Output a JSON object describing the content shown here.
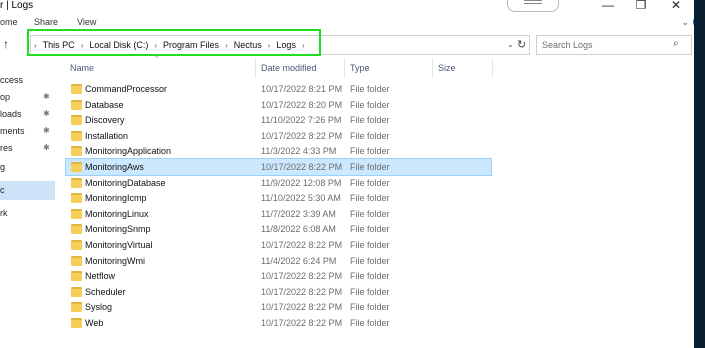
{
  "window": {
    "title": "r | Logs",
    "minimize": "—",
    "maximize": "❐",
    "close": "✕"
  },
  "ribbon": {
    "tabs": [
      "ome",
      "Share",
      "View"
    ]
  },
  "address": {
    "crumbs": [
      "This PC",
      "Local Disk (C:)",
      "Program Files",
      "Nectus",
      "Logs"
    ],
    "highlight_color": "#22dd22"
  },
  "search": {
    "placeholder": "Search Logs"
  },
  "sidebar": {
    "items": [
      {
        "label": "ccess",
        "pinned": false
      },
      {
        "label": "op",
        "pinned": true
      },
      {
        "label": "loads",
        "pinned": true
      },
      {
        "label": "ments",
        "pinned": true
      },
      {
        "label": "res",
        "pinned": true
      },
      {
        "label": "g",
        "pinned": false
      },
      {
        "label": "c",
        "pinned": false,
        "selected": true
      },
      {
        "label": "rk",
        "pinned": false
      }
    ]
  },
  "columns": {
    "name": "Name",
    "date": "Date modified",
    "type": "Type",
    "size": "Size"
  },
  "files": [
    {
      "name": "CommandProcessor",
      "date": "10/17/2022 8:21 PM",
      "type": "File folder"
    },
    {
      "name": "Database",
      "date": "10/17/2022 8:20 PM",
      "type": "File folder"
    },
    {
      "name": "Discovery",
      "date": "11/10/2022 7:26 PM",
      "type": "File folder"
    },
    {
      "name": "Installation",
      "date": "10/17/2022 8:22 PM",
      "type": "File folder"
    },
    {
      "name": "MonitoringApplication",
      "date": "11/3/2022 4:33 PM",
      "type": "File folder"
    },
    {
      "name": "MonitoringAws",
      "date": "10/17/2022 8:22 PM",
      "type": "File folder",
      "selected": true
    },
    {
      "name": "MonitoringDatabase",
      "date": "11/9/2022 12:08 PM",
      "type": "File folder"
    },
    {
      "name": "MonitoringIcmp",
      "date": "11/10/2022 5:30 AM",
      "type": "File folder"
    },
    {
      "name": "MonitoringLinux",
      "date": "11/7/2022 3:39 AM",
      "type": "File folder"
    },
    {
      "name": "MonitoringSnmp",
      "date": "11/8/2022 6:08 AM",
      "type": "File folder"
    },
    {
      "name": "MonitoringVirtual",
      "date": "10/17/2022 8:22 PM",
      "type": "File folder"
    },
    {
      "name": "MonitoringWmi",
      "date": "11/4/2022 6:24 PM",
      "type": "File folder"
    },
    {
      "name": "Netflow",
      "date": "10/17/2022 8:22 PM",
      "type": "File folder"
    },
    {
      "name": "Scheduler",
      "date": "10/17/2022 8:22 PM",
      "type": "File folder"
    },
    {
      "name": "Syslog",
      "date": "10/17/2022 8:22 PM",
      "type": "File folder"
    },
    {
      "name": "Web",
      "date": "10/17/2022 8:22 PM",
      "type": "File folder"
    }
  ]
}
